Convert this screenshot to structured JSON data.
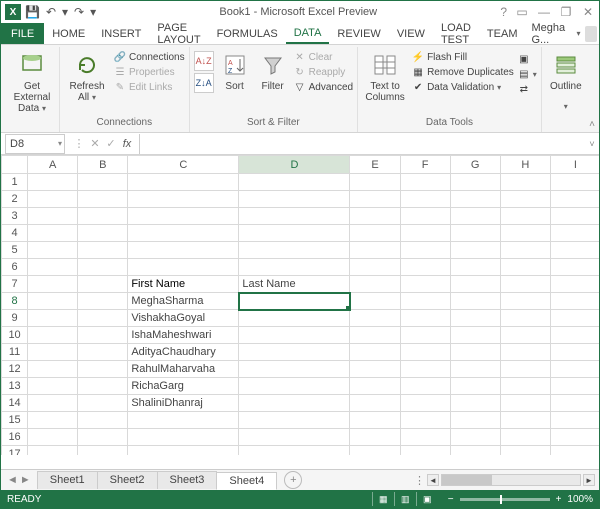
{
  "title": "Book1 - Microsoft Excel Preview",
  "qat": {
    "save": "💾",
    "undo": "↶",
    "redo": "↷"
  },
  "menus": {
    "file": "FILE",
    "tabs": [
      "HOME",
      "INSERT",
      "PAGE LAYOUT",
      "FORMULAS",
      "DATA",
      "REVIEW",
      "VIEW",
      "LOAD TEST",
      "TEAM"
    ],
    "active": "DATA",
    "user": "Megha G..."
  },
  "ribbon": {
    "groups": {
      "connections_label": "Connections",
      "sortfilter_label": "Sort & Filter",
      "datatools_label": "Data Tools"
    },
    "get_external": "Get External\nData",
    "refresh_all": "Refresh\nAll",
    "connections": "Connections",
    "properties": "Properties",
    "edit_links": "Edit Links",
    "sort": "Sort",
    "filter": "Filter",
    "clear": "Clear",
    "reapply": "Reapply",
    "advanced": "Advanced",
    "text_to_columns": "Text to\nColumns",
    "flash_fill": "Flash Fill",
    "remove_duplicates": "Remove Duplicates",
    "data_validation": "Data Validation",
    "outline": "Outline"
  },
  "namebox": "D8",
  "columns": [
    "A",
    "B",
    "C",
    "D",
    "E",
    "F",
    "G",
    "H",
    "I"
  ],
  "rows_visible": 18,
  "selected_cell": "D8",
  "cells": {
    "C7": {
      "v": "First Name",
      "bold": true
    },
    "D7": {
      "v": "Last Name"
    },
    "C8": {
      "v": "MeghaSharma"
    },
    "C9": {
      "v": "VishakhaGoyal"
    },
    "C10": {
      "v": "IshaMaheshwari"
    },
    "C11": {
      "v": "AdityaChaudhary"
    },
    "C12": {
      "v": "RahulMaharvaha"
    },
    "C13": {
      "v": "RichaGarg"
    },
    "C14": {
      "v": "ShaliniDhanraj"
    }
  },
  "sheets": [
    "Sheet1",
    "Sheet2",
    "Sheet3",
    "Sheet4"
  ],
  "active_sheet": "Sheet4",
  "status": {
    "ready": "READY",
    "zoom": "100%"
  }
}
